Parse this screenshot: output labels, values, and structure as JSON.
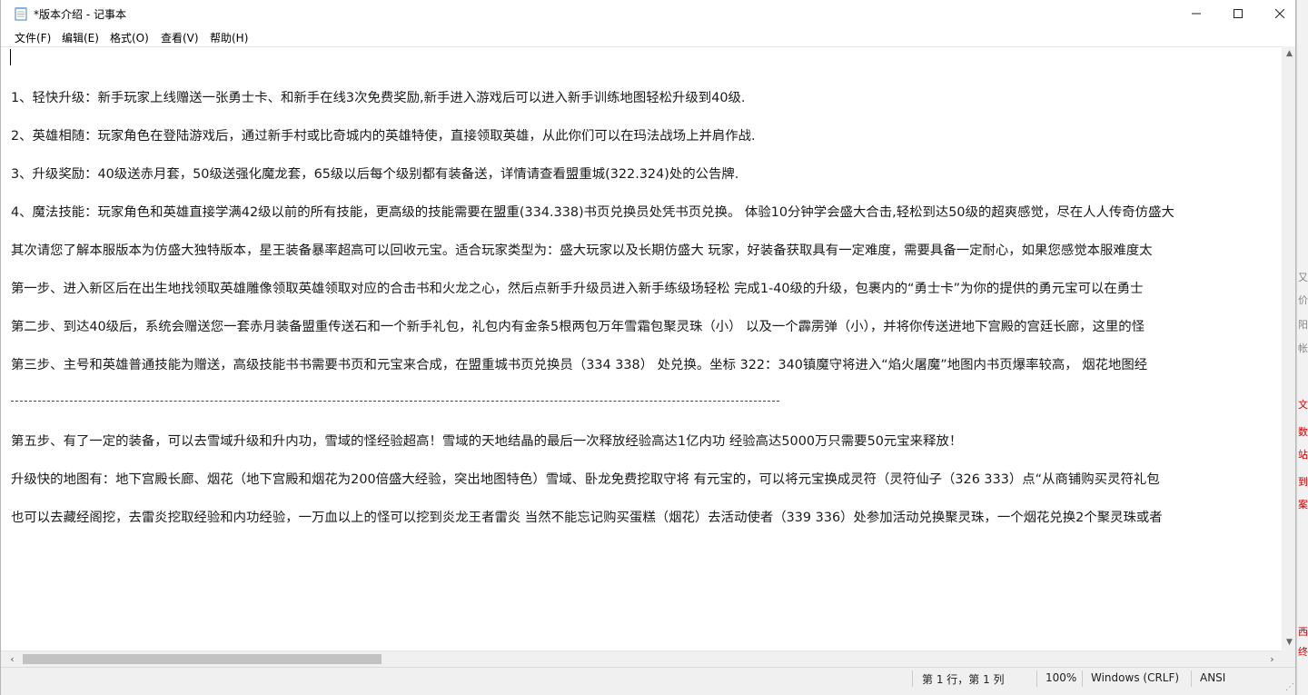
{
  "window": {
    "title": "*版本介绍 - 记事本",
    "min_glyph": "—",
    "max_glyph": "☐",
    "close_glyph": "✕"
  },
  "menu": {
    "file": "文件(F)",
    "edit": "编辑(E)",
    "format": "格式(O)",
    "view": "查看(V)",
    "help": "帮助(H)"
  },
  "lines": [
    "1、轻快升级：新手玩家上线赠送一张勇士卡、和新手在线3次免费奖励,新手进入游戏后可以进入新手训练地图轻松升级到40级.",
    "2、英雄相随：玩家角色在登陆游戏后，通过新手村或比奇城内的英雄特使，直接领取英雄，从此你们可以在玛法战场上并肩作战.",
    "3、升级奖励：40级送赤月套，50级送强化魔龙套，65级以后每个级别都有装备送，详情请查看盟重城(322.324)处的公告牌.",
    "4、魔法技能：玩家角色和英雄直接学满42级以前的所有技能，更高级的技能需要在盟重(334.338)书页兑换员处凭书页兑换。 体验10分钟学会盛大合击,轻松到达50级的超爽感觉，尽在人人传奇仿盛大",
    "其次请您了解本服版本为仿盛大独特版本，星王装备暴率超高可以回收元宝。适合玩家类型为：盛大玩家以及长期仿盛大 玩家，好装备获取具有一定难度，需要具备一定耐心，如果您感觉本服难度太",
    "第一步、进入新区后在出生地找领取英雄雕像领取英雄领取对应的合击书和火龙之心，然后点新手升级员进入新手练级场轻松 完成1-40级的升级，包裹内的“勇士卡”为你的提供的勇元宝可以在勇士",
    "第二步、到达40级后，系统会赠送您一套赤月装备盟重传送石和一个新手礼包，礼包内有金条5根两包万年雪霜包聚灵珠（小） 以及一个霹雳弹（小），并将你传送进地下宫殿的宫廷长廊，这里的怪",
    "第三步、主号和英雄普通技能为赠送，高级技能书书需要书页和元宝来合成，在盟重城书页兑换员（334 338） 处兑换。坐标 322：340镇魔守将进入“焰火屠魔”地图内书页爆率较高， 烟花地图经",
    "第五步、有了一定的装备，可以去雪域升级和升内功，雪域的怪经验超高！雪域的天地结晶的最后一次释放经验高达1亿内功 经验高达5000万只需要50元宝来释放！",
    "升级快的地图有：地下宫殿长廊、烟花（地下宫殿和烟花为200倍盛大经验，突出地图特色）雪域、卧龙免费挖取守将 有元宝的，可以将元宝换成灵符（灵符仙子（326 333）点“从商铺购买灵符礼包",
    "也可以去藏经阁挖，去雷炎挖取经验和内功经验，一万血以上的怪可以挖到炎龙王者雷炎 当然不能忘记购买蛋糕（烟花）去活动使者（339 336）处参加活动兑换聚灵珠，一个烟花兑换2个聚灵珠或者"
  ],
  "statusbar": {
    "position": "第 1 行，第 1 列",
    "zoom": "100%",
    "line_ending": "Windows (CRLF)",
    "encoding": "ANSI"
  },
  "background_app": {
    "glyphs": [
      "又",
      "价",
      "阳",
      "帐",
      "文",
      "数",
      "站",
      "到",
      "案",
      "西",
      "终"
    ]
  }
}
